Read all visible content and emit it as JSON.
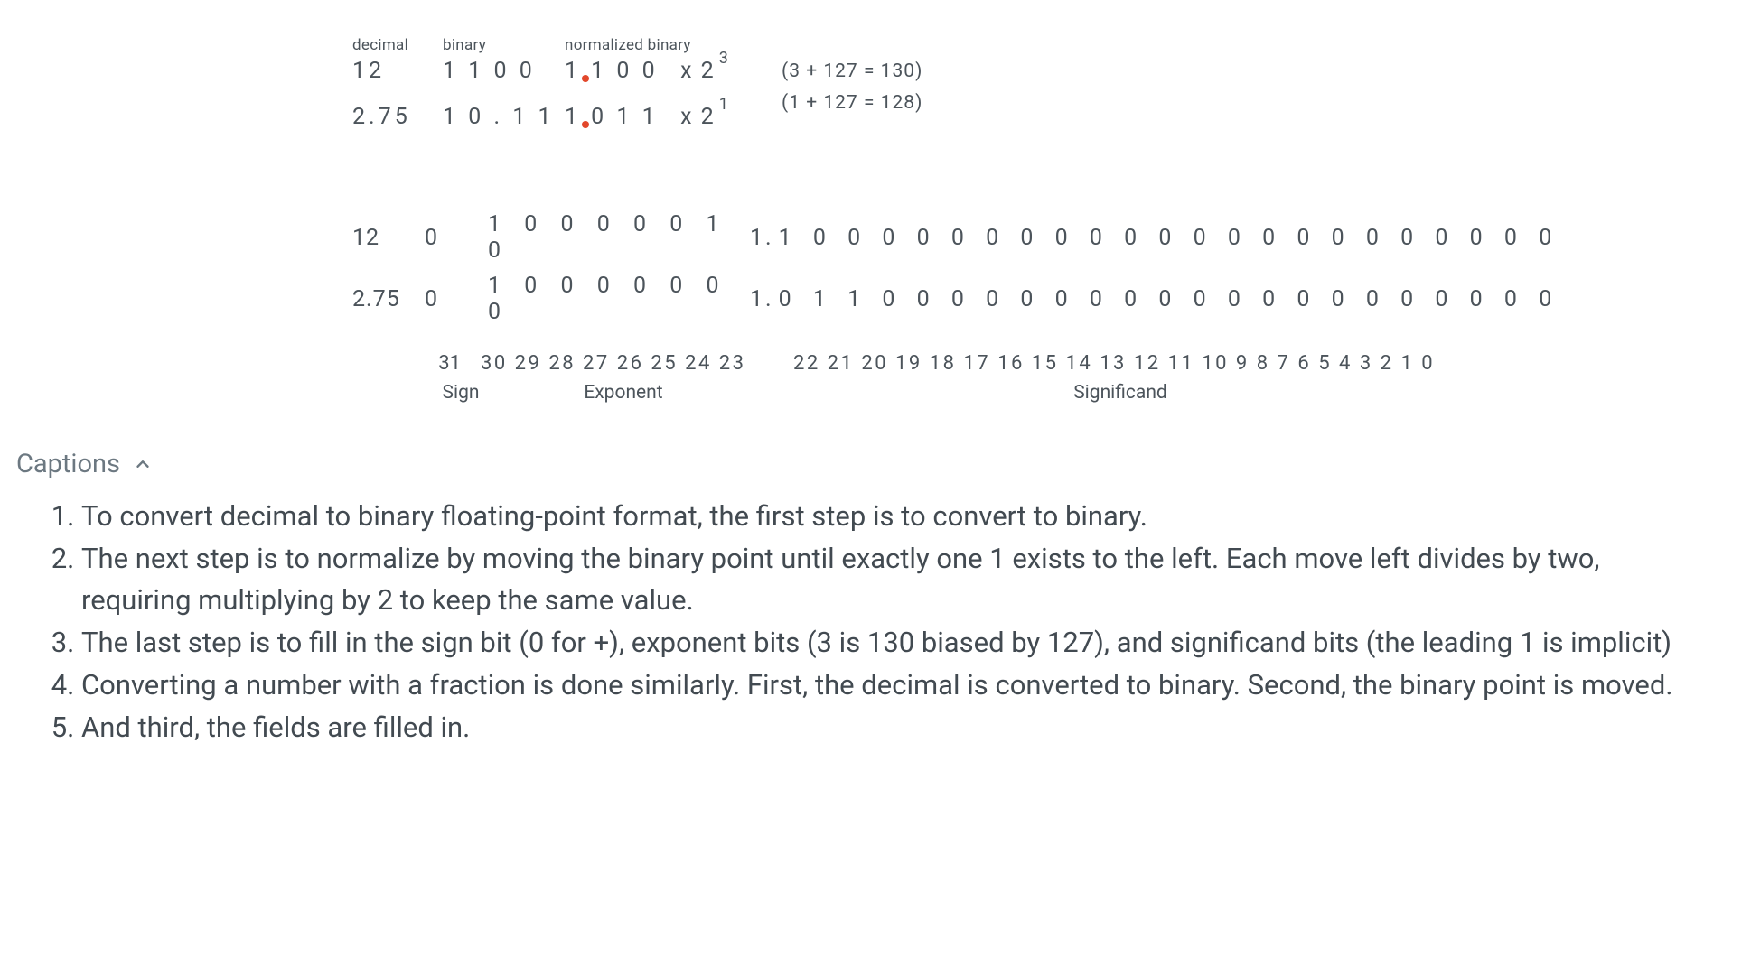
{
  "figure": {
    "headers": {
      "decimal": "decimal",
      "binary": "binary",
      "normalized": "normalized binary"
    },
    "rows": [
      {
        "decimal": "12",
        "binary_spaced": "1 1 0 0",
        "norm_before": "1",
        "norm_after": "1 0 0",
        "exp_base": "x 2",
        "exp_sup": "3",
        "note": "(3 + 127 = 130)"
      },
      {
        "decimal": "2.75",
        "binary_spaced": "1 0 . 1 1",
        "norm_before": "1",
        "norm_after": "0 1 1",
        "exp_base": "x 2",
        "exp_sup": "1",
        "note": "(1 + 127 = 128)"
      }
    ]
  },
  "ieee": {
    "rows": [
      {
        "label": "12",
        "sign": "0",
        "exponent": "1 0 0 0 0 0 1 0",
        "mant_lead": "1.",
        "mantissa": "1 0 0 0 0 0 0 0 0 0 0 0 0 0 0 0 0 0 0 0 0 0 0"
      },
      {
        "label": "2.75",
        "sign": "0",
        "exponent": "1 0 0 0 0 0 0 0",
        "mant_lead": "1.",
        "mantissa": "0 1 1 0 0 0 0 0 0 0 0 0 0 0 0 0 0 0 0 0 0 0 0"
      }
    ],
    "bit_indices": {
      "sign": "31",
      "exponent": "30 29 28 27 26 25 24 23",
      "mantissa": "22 21 20 19 18 17 16 15  14 13 12 11 10  9  8  7   6  5  4  3  2  1  0"
    },
    "field_labels": {
      "sign": "Sign",
      "exponent": "Exponent",
      "mantissa": "Significand"
    }
  },
  "captions": {
    "title": "Captions",
    "items": [
      "To convert decimal to binary floating-point format, the first step is to convert to binary.",
      "The next step is to normalize by moving the binary point until exactly one 1 exists to the left. Each move left divides by two, requiring multiplying by 2 to keep the same value.",
      "The last step is to fill in the sign bit (0 for +), exponent bits (3 is 130 biased by 127), and significand bits (the leading 1 is implicit)",
      "Converting a number with a fraction is done similarly. First, the decimal is converted to binary. Second, the binary point is moved.",
      "And third, the fields are filled in."
    ]
  }
}
